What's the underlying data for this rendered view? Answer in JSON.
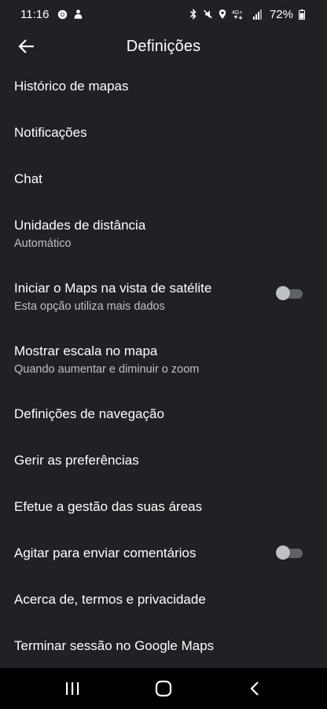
{
  "status_bar": {
    "time": "11:16",
    "battery": "72%",
    "network": "4G+"
  },
  "app_bar": {
    "title": "Definições",
    "back_icon": "arrow-back-icon"
  },
  "settings": [
    {
      "title": "Histórico de mapas",
      "subtitle": "",
      "toggle": null
    },
    {
      "title": "Notificações",
      "subtitle": "",
      "toggle": null
    },
    {
      "title": "Chat",
      "subtitle": "",
      "toggle": null
    },
    {
      "title": "Unidades de distância",
      "subtitle": "Automático",
      "toggle": null
    },
    {
      "title": "Iniciar o Maps na vista de satélite",
      "subtitle": "Esta opção utiliza mais dados",
      "toggle": false
    },
    {
      "title": "Mostrar escala no mapa",
      "subtitle": "Quando aumentar e diminuir o zoom",
      "toggle": null
    },
    {
      "title": "Definições de navegação",
      "subtitle": "",
      "toggle": null
    },
    {
      "title": "Gerir as preferências",
      "subtitle": "",
      "toggle": null
    },
    {
      "title": "Efetue a gestão das suas áreas",
      "subtitle": "",
      "toggle": null
    },
    {
      "title": "Agitar para enviar comentários",
      "subtitle": "",
      "toggle": false
    },
    {
      "title": "Acerca de, termos e privacidade",
      "subtitle": "",
      "toggle": null
    },
    {
      "title": "Terminar sessão no Google Maps",
      "subtitle": "",
      "toggle": null
    }
  ],
  "nav_bar": {
    "recents_icon": "recent-apps-icon",
    "home_icon": "home-icon",
    "back_icon": "back-icon"
  },
  "colors": {
    "background": "#202124",
    "text_primary": "#ffffff",
    "text_secondary": "#bdc1c6",
    "toggle_track_off": "#5f6368",
    "toggle_thumb_off": "#bdc1c6",
    "nav_bar": "#000000"
  }
}
